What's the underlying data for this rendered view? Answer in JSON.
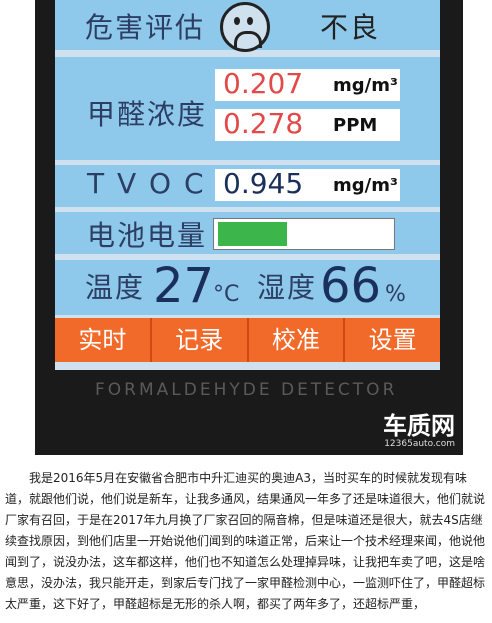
{
  "device": {
    "risk_label": "危害评估",
    "risk_value": "不良",
    "formaldehyde_label": "甲醛浓度",
    "formaldehyde_mg": "0.207",
    "formaldehyde_mg_unit": "mg/m³",
    "formaldehyde_ppm": "0.278",
    "formaldehyde_ppm_unit": "PPM",
    "tvoc_label": "T V O C",
    "tvoc_value": "0.945",
    "tvoc_unit": "mg/m³",
    "battery_label": "电池电量",
    "battery_level": 0.4,
    "temp_label": "温度",
    "temp_value": "27",
    "temp_unit": "°C",
    "humidity_label": "湿度",
    "humidity_value": "66",
    "humidity_unit": "%",
    "tabs": [
      "实时",
      "记录",
      "校准",
      "设置"
    ],
    "engraved_text": "FORMALDEHYDE DETECTOR"
  },
  "watermark": {
    "brand": "车质网",
    "site": "12365auto.com"
  },
  "article": {
    "text": "我是2016年5月在安徽省合肥市中升汇迪买的奥迪A3，当时买车的时候就发现有味道，就跟他们说，他们说是新车，让我多通风，结果通风一年多了还是味道很大，他们就说厂家有召回，于是在2017年九月换了厂家召回的隔音棉，但是味道还是很大，就去4S店继续查找原因，到他们店里一开始说他们闻到的味道正常，后来让一个技术经理来闻，他说他闻到了，说没办法，这车都这样，他们也不知道怎么处理掉异味，让我把车卖了吧，这是啥意思，没办法，我只能开走，到家后专门找了一家甲醛检测中心，一监测吓住了，甲醛超标太严重，这下好了，甲醛超标是无形的杀人啊，都买了两年多了，还超标严重，"
  }
}
